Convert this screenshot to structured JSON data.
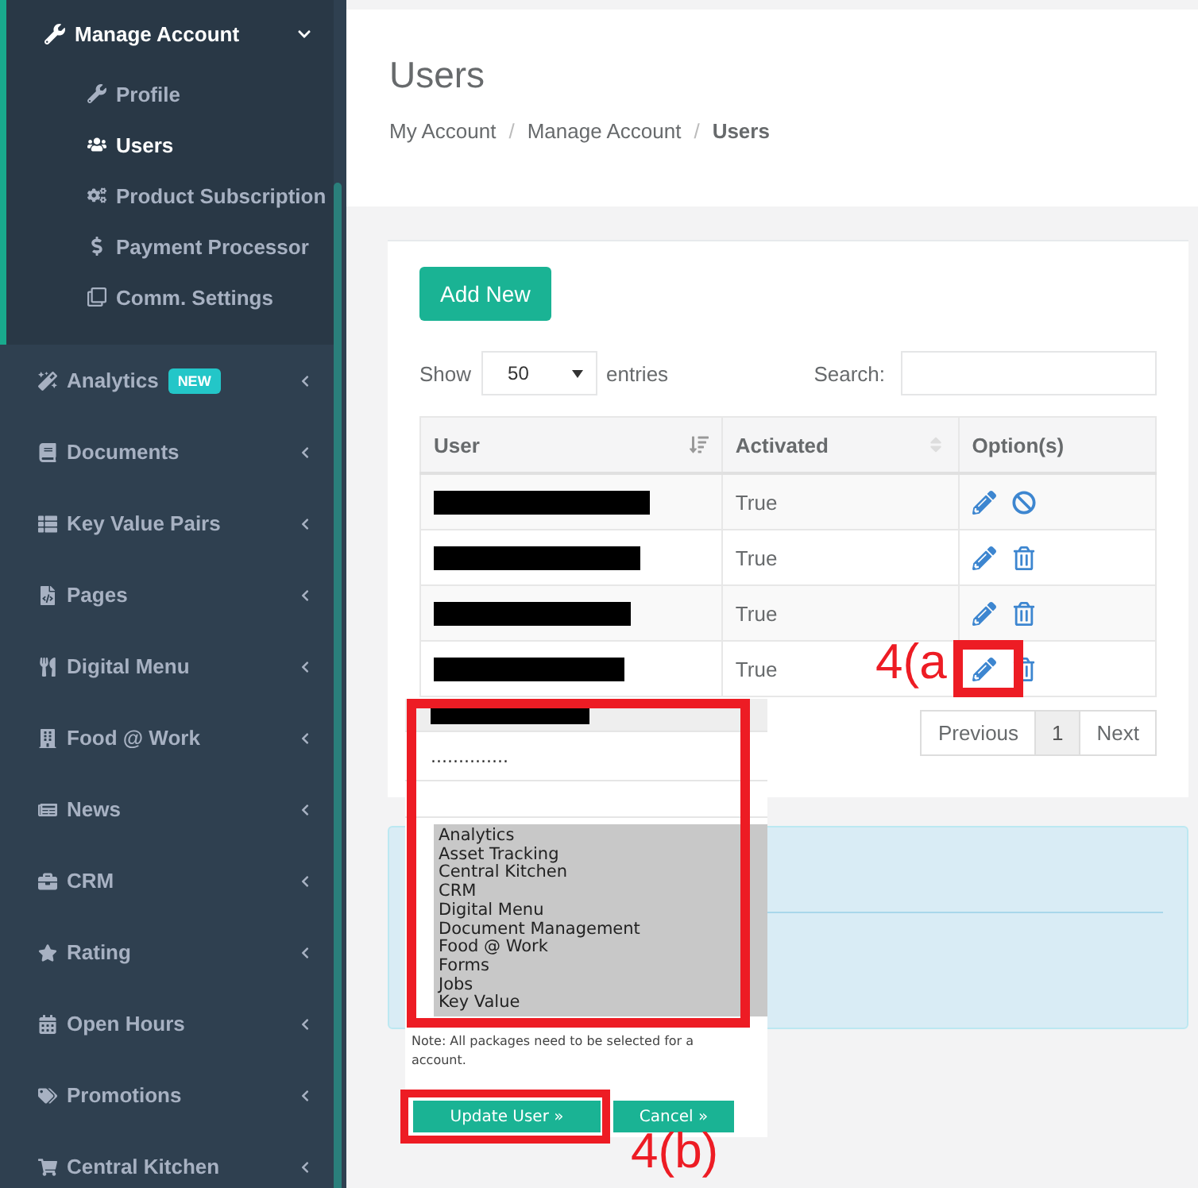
{
  "sidebar": {
    "items": [
      {
        "label": "Manage Account",
        "expanded": true,
        "children": [
          {
            "label": "Profile",
            "selected": false
          },
          {
            "label": "Users",
            "selected": true
          },
          {
            "label": "Product Subscription",
            "selected": false
          },
          {
            "label": "Payment Processor",
            "selected": false
          },
          {
            "label": "Comm. Settings",
            "selected": false
          }
        ]
      },
      {
        "label": "Analytics",
        "badge": "NEW",
        "expanded": false
      },
      {
        "label": "Documents",
        "expanded": false
      },
      {
        "label": "Key Value Pairs",
        "expanded": false
      },
      {
        "label": "Pages",
        "expanded": false
      },
      {
        "label": "Digital Menu",
        "expanded": false
      },
      {
        "label": "Food @ Work",
        "expanded": false
      },
      {
        "label": "News",
        "expanded": false
      },
      {
        "label": "CRM",
        "expanded": false
      },
      {
        "label": "Rating",
        "expanded": false
      },
      {
        "label": "Open Hours",
        "expanded": false
      },
      {
        "label": "Promotions",
        "expanded": false
      },
      {
        "label": "Central Kitchen",
        "expanded": false
      }
    ]
  },
  "page": {
    "title": "Users",
    "breadcrumb": [
      "My Account",
      "Manage Account",
      "Users"
    ],
    "breadcrumb_separator": "/"
  },
  "toolbar": {
    "add_button": "Add New",
    "show_label": "Show",
    "page_size": "50",
    "entries_label": "entries",
    "search_label": "Search:"
  },
  "table": {
    "columns": [
      {
        "label": "User",
        "sorted": true
      },
      {
        "label": "Activated",
        "sorted": false
      },
      {
        "label": "Option(s)"
      }
    ],
    "rows": [
      {
        "activated": "True",
        "deletable": false
      },
      {
        "activated": "True",
        "deletable": true
      },
      {
        "activated": "True",
        "deletable": true
      },
      {
        "activated": "True",
        "deletable": true
      }
    ]
  },
  "pagination": [
    {
      "label": "Previous",
      "selected": false
    },
    {
      "label": "1",
      "selected": true
    },
    {
      "label": "Next",
      "selected": false
    }
  ],
  "edit_form": {
    "password": "..............",
    "packages": [
      "Analytics",
      "Asset Tracking",
      "Central Kitchen",
      "CRM",
      "Digital Menu",
      "Document Management",
      "Food @ Work",
      "Forms",
      "Jobs",
      "Key Value"
    ],
    "note": [
      "Note: All packages need to be selected for a",
      "account."
    ],
    "buttons": [
      "Update User »",
      "Cancel »"
    ]
  },
  "annotations": [
    {
      "label": "4(a"
    },
    {
      "label": "4(b)"
    }
  ]
}
